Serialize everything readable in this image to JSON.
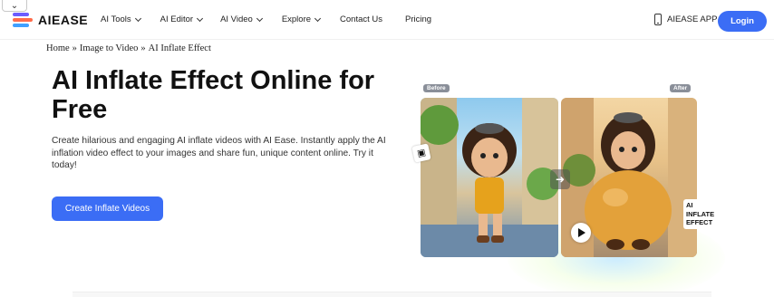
{
  "nav": {
    "logo_text": "AIEASE",
    "menu": [
      {
        "label": "AI Tools",
        "dropdown": true
      },
      {
        "label": "AI Editor",
        "dropdown": true
      },
      {
        "label": "AI Video",
        "dropdown": true
      },
      {
        "label": "Explore",
        "dropdown": true
      },
      {
        "label": "Contact Us",
        "dropdown": false
      },
      {
        "label": "Pricing",
        "dropdown": false
      }
    ],
    "app_label": "AIEASE APP",
    "login_label": "Login",
    "collapse_glyph": "⌄"
  },
  "breadcrumb": {
    "home": "Home",
    "sep1": "»",
    "parent": "Image to Video",
    "sep2": "»",
    "current": "AI Inflate Effect"
  },
  "hero": {
    "title": "AI Inflate Effect Online for Free",
    "description": "Create hilarious and engaging AI inflate videos with AI Ease. Instantly apply the AI inflation video effect to your images and share fun, unique content online. Try it today!",
    "cta_label": "Create Inflate Videos"
  },
  "showcase": {
    "before_tag": "Before",
    "after_tag": "After",
    "effect_label": "AI INFLATE EFFECT",
    "swap_glyph": "➜",
    "image_glyph": "▣"
  },
  "colors": {
    "accent": "#3b6df5",
    "logo_purple": "#6b5cff",
    "logo_orange": "#ff6b4a",
    "logo_blue": "#3fa0ff"
  }
}
